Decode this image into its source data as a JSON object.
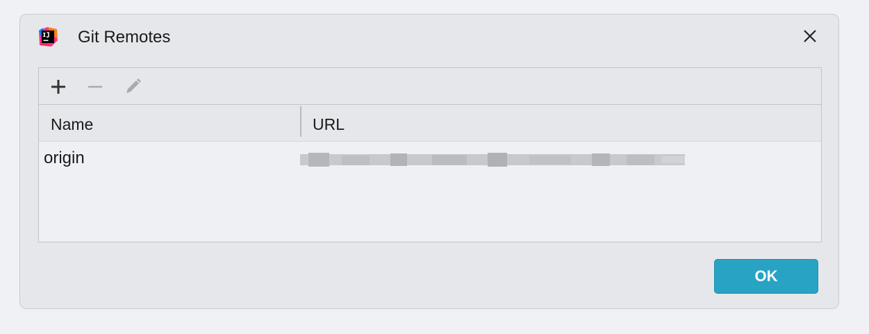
{
  "dialog": {
    "title": "Git Remotes",
    "app_icon": "intellij-idea-icon",
    "close_icon": "close-icon"
  },
  "toolbar": {
    "add_icon": "plus-icon",
    "remove_icon": "minus-icon",
    "edit_icon": "pencil-icon"
  },
  "table": {
    "columns": [
      "Name",
      "URL"
    ],
    "rows": [
      {
        "name": "origin",
        "url": ""
      }
    ]
  },
  "footer": {
    "ok_label": "OK"
  },
  "colors": {
    "ok_button": "#28a3c4",
    "dialog_bg": "#e6e7eb",
    "table_bg": "#eff0f4"
  }
}
